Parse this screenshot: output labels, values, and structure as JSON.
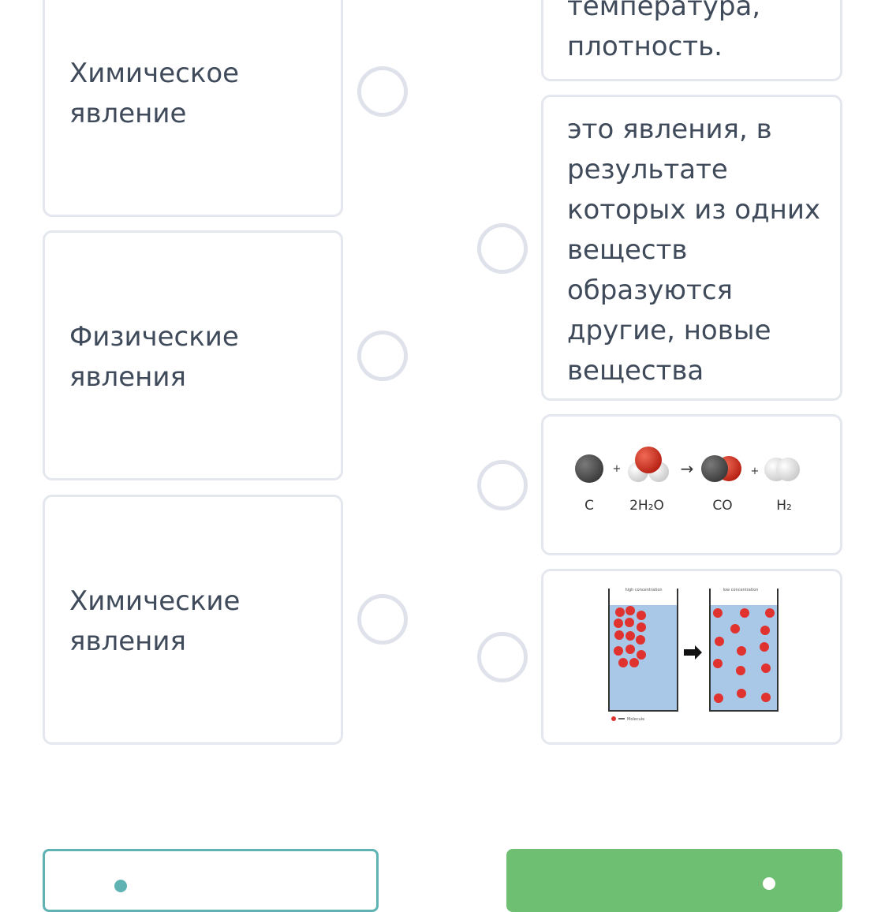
{
  "left_items": [
    {
      "text": "Химическое\nявление"
    },
    {
      "text": "Физические\nявления"
    },
    {
      "text": "Химические\nявления"
    }
  ],
  "right_items": {
    "top_partial": {
      "text": "температура,\nплотность."
    },
    "definition": {
      "text": "это явления, в\nрезультате\nкоторых из одних\nвеществ\nобразуются\nдругие, новые\nвещества"
    },
    "reaction_image": {
      "plus1": "+",
      "plus2": "+",
      "arrow": "→",
      "labels": [
        "C",
        "2H₂O",
        "CO",
        "H₂"
      ]
    },
    "diffusion_image": {
      "left_beaker_caption": "high concentration",
      "right_beaker_caption": "low concentration",
      "legend_label": "Molecule"
    }
  },
  "colors": {
    "card_border": "#e5e7ee",
    "text": "#3f4a5a",
    "radio_border": "#dfe2ea",
    "outline_button": "#5fb3b3",
    "green_button": "#6fbf73",
    "water": "#a9c7e6",
    "molecule": "#e0332f"
  }
}
